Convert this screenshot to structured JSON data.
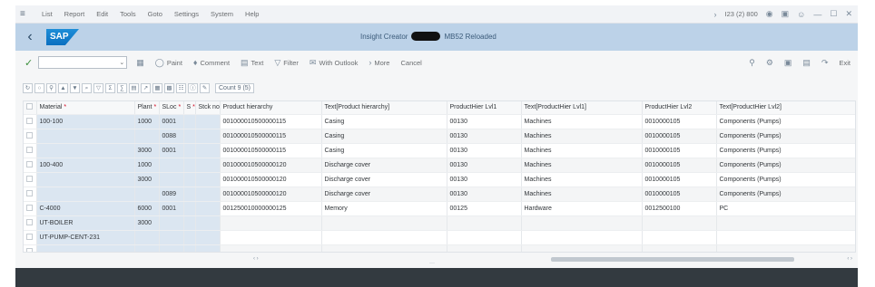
{
  "menu": {
    "items": [
      "List",
      "Report",
      "Edit",
      "Tools",
      "Goto",
      "Settings",
      "System",
      "Help"
    ],
    "system_info": "I23 (2) 800"
  },
  "titlebar": {
    "logo": "SAP",
    "title_prefix": "Insight Creator",
    "title_suffix": "MB52 Reloaded"
  },
  "toolbar": {
    "command_placeholder": "",
    "buttons": [
      {
        "label": "Paint",
        "icon": "paint-icon"
      },
      {
        "label": "Comment",
        "icon": "comment-icon"
      },
      {
        "label": "Text",
        "icon": "text-icon"
      },
      {
        "label": "Filter",
        "icon": "filter-icon"
      },
      {
        "label": "With Outlook",
        "icon": "mail-icon"
      },
      {
        "label": "More",
        "icon": "chevron-right-icon"
      }
    ],
    "cancel": "Cancel",
    "exit": "Exit"
  },
  "alv": {
    "count_label": "Count 9 (5)"
  },
  "table": {
    "columns": [
      {
        "label": "Material",
        "required": true
      },
      {
        "label": "Plant",
        "required": true
      },
      {
        "label": "SLoc",
        "required": true
      },
      {
        "label": "S",
        "required": true
      },
      {
        "label": "Stck no.",
        "required": false
      },
      {
        "label": "Product hierarchy",
        "required": false
      },
      {
        "label": "Text[Product hierarchy]",
        "required": false
      },
      {
        "label": "ProductHier Lvl1",
        "required": false
      },
      {
        "label": "Text[ProductHier Lvl1]",
        "required": false
      },
      {
        "label": "ProductHier Lvl2",
        "required": false
      },
      {
        "label": "Text[ProductHier Lvl2]",
        "required": false
      }
    ],
    "rows": [
      [
        "100-100",
        "1000",
        "0001",
        "",
        "",
        "001000010500000115",
        "Casing",
        "00130",
        "Machines",
        "0010000105",
        "Components (Pumps)"
      ],
      [
        "",
        "",
        "0088",
        "",
        "",
        "001000010500000115",
        "Casing",
        "00130",
        "Machines",
        "0010000105",
        "Components (Pumps)"
      ],
      [
        "",
        "3000",
        "0001",
        "",
        "",
        "001000010500000115",
        "Casing",
        "00130",
        "Machines",
        "0010000105",
        "Components (Pumps)"
      ],
      [
        "100-400",
        "1000",
        "",
        "",
        "",
        "001000010500000120",
        "Discharge cover",
        "00130",
        "Machines",
        "0010000105",
        "Components (Pumps)"
      ],
      [
        "",
        "3000",
        "",
        "",
        "",
        "001000010500000120",
        "Discharge cover",
        "00130",
        "Machines",
        "0010000105",
        "Components (Pumps)"
      ],
      [
        "",
        "",
        "0089",
        "",
        "",
        "001000010500000120",
        "Discharge cover",
        "00130",
        "Machines",
        "0010000105",
        "Components (Pumps)"
      ],
      [
        "C-4000",
        "6000",
        "0001",
        "",
        "",
        "001250010000000125",
        "Memory",
        "00125",
        "Hardware",
        "0012500100",
        "PC"
      ],
      [
        "UT-BOILER",
        "3000",
        "",
        "",
        "",
        "",
        "",
        "",
        "",
        "",
        ""
      ],
      [
        "UT-PUMP-CENT-231",
        "",
        "",
        "",
        "",
        "",
        "",
        "",
        "",
        "",
        ""
      ],
      [
        "",
        "",
        "",
        "",
        "",
        "",
        "",
        "",
        "",
        "",
        ""
      ]
    ]
  }
}
